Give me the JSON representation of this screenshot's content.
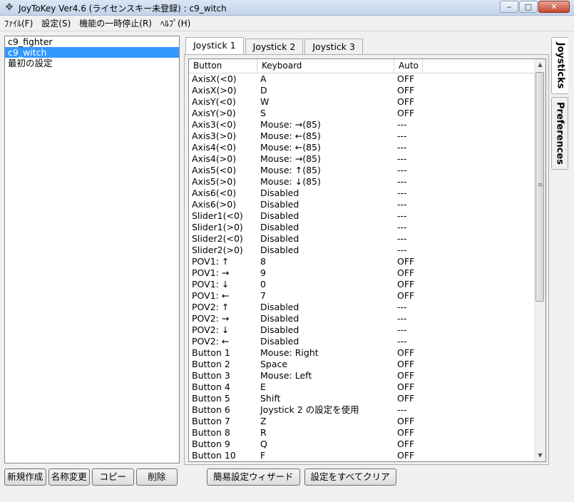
{
  "window": {
    "title": "JoyToKey Ver4.6 (ライセンスキー未登録) : c9_witch",
    "minimize_glyph": "‒",
    "maximize_glyph": "□",
    "close_glyph": "✕"
  },
  "menu": [
    "ﾌｧｲﾙ(F)",
    "設定(S)",
    "機能の一時停止(R)",
    "ﾍﾙﾌﾟ(H)"
  ],
  "configs": [
    "c9_fighter",
    "c9_witch",
    "最初の設定"
  ],
  "selected_config": "c9_witch",
  "left_buttons": [
    "新規作成",
    "名称変更",
    "コピー",
    "削除"
  ],
  "tabs": [
    "Joystick 1",
    "Joystick 2",
    "Joystick 3"
  ],
  "active_tab": "Joystick 1",
  "columns": [
    "Button",
    "Keyboard",
    "Auto"
  ],
  "rows": [
    [
      "AxisX(<0)",
      "A",
      "OFF"
    ],
    [
      "AxisX(>0)",
      "D",
      "OFF"
    ],
    [
      "AxisY(<0)",
      "W",
      "OFF"
    ],
    [
      "AxisY(>0)",
      "S",
      "OFF"
    ],
    [
      "Axis3(<0)",
      "Mouse: →(85)",
      "---"
    ],
    [
      "Axis3(>0)",
      "Mouse: ←(85)",
      "---"
    ],
    [
      "Axis4(<0)",
      "Mouse: ←(85)",
      "---"
    ],
    [
      "Axis4(>0)",
      "Mouse: →(85)",
      "---"
    ],
    [
      "Axis5(<0)",
      "Mouse: ↑(85)",
      "---"
    ],
    [
      "Axis5(>0)",
      "Mouse: ↓(85)",
      "---"
    ],
    [
      "Axis6(<0)",
      "Disabled",
      "---"
    ],
    [
      "Axis6(>0)",
      "Disabled",
      "---"
    ],
    [
      "Slider1(<0)",
      "Disabled",
      "---"
    ],
    [
      "Slider1(>0)",
      "Disabled",
      "---"
    ],
    [
      "Slider2(<0)",
      "Disabled",
      "---"
    ],
    [
      "Slider2(>0)",
      "Disabled",
      "---"
    ],
    [
      "POV1: ↑",
      "8",
      "OFF"
    ],
    [
      "POV1: →",
      "9",
      "OFF"
    ],
    [
      "POV1: ↓",
      "0",
      "OFF"
    ],
    [
      "POV1: ←",
      "7",
      "OFF"
    ],
    [
      "POV2: ↑",
      "Disabled",
      "---"
    ],
    [
      "POV2: →",
      "Disabled",
      "---"
    ],
    [
      "POV2: ↓",
      "Disabled",
      "---"
    ],
    [
      "POV2: ←",
      "Disabled",
      "---"
    ],
    [
      "Button 1",
      "Mouse: Right",
      "OFF"
    ],
    [
      "Button 2",
      "Space",
      "OFF"
    ],
    [
      "Button 3",
      "Mouse: Left",
      "OFF"
    ],
    [
      "Button 4",
      "E",
      "OFF"
    ],
    [
      "Button 5",
      "Shift",
      "OFF"
    ],
    [
      "Button 6",
      "Joystick 2 の設定を使用",
      "---"
    ],
    [
      "Button 7",
      "Z",
      "OFF"
    ],
    [
      "Button 8",
      "R",
      "OFF"
    ],
    [
      "Button 9",
      "Q",
      "OFF"
    ],
    [
      "Button 10",
      "F",
      "OFF"
    ]
  ],
  "bottom_buttons": [
    "簡易設定ウィザード",
    "設定をすべてクリア"
  ],
  "side_tabs": [
    "Joysticks",
    "Preferences"
  ]
}
